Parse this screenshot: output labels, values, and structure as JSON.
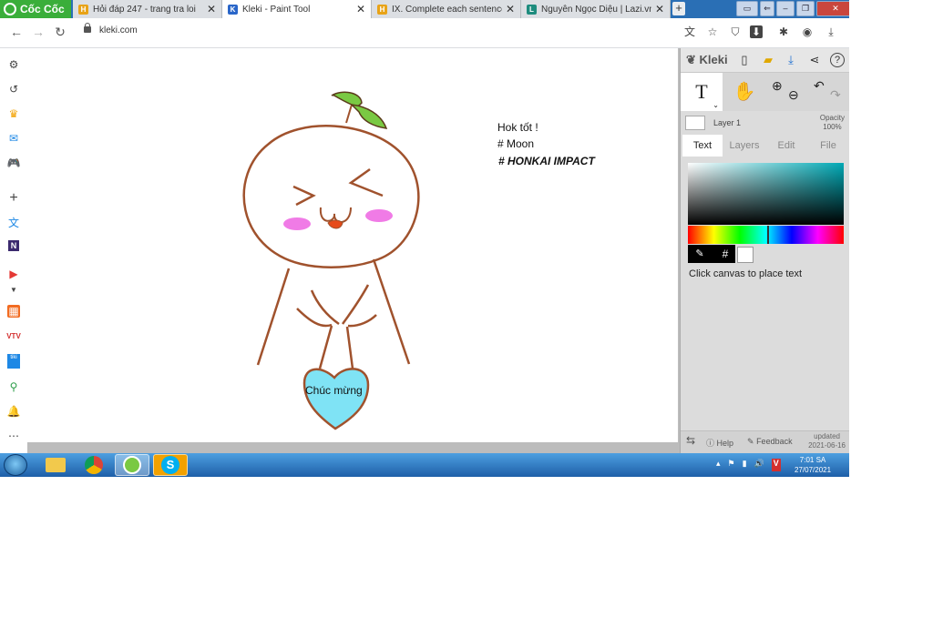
{
  "browser": {
    "brand": "Cốc Cốc",
    "tabs": [
      {
        "title": "Hỏi đáp 247 - trang tra loi",
        "favicon": "H",
        "color": "#e8a317",
        "active": false
      },
      {
        "title": "Kleki - Paint Tool",
        "favicon": "K",
        "color": "#2a66c9",
        "active": true
      },
      {
        "title": "IX. Complete each sentence",
        "favicon": "H",
        "color": "#e8a317",
        "active": false
      },
      {
        "title": "Nguyễn Ngọc Diệu | Lazi.vn",
        "favicon": "L",
        "color": "#1e8c7e",
        "active": false
      }
    ],
    "url": "kleki.com"
  },
  "canvas": {
    "text_line1": "Hok tốt !",
    "text_line2": "# Moon",
    "text_line3": "# HONKAI IMPACT",
    "heart_text": "Chúc mừng"
  },
  "panel": {
    "logo": "Kleki",
    "layer_name": "Layer 1",
    "opacity_label": "Opacity",
    "opacity_value": "100%",
    "tabs": [
      "Text",
      "Layers",
      "Edit",
      "File"
    ],
    "active_tab": "Text",
    "hint": "Click canvas to place text",
    "footer": {
      "help": "Help",
      "feedback": "Feedback",
      "updated_label": "updated",
      "updated_date": "2021-06-16"
    },
    "hash_label": "#"
  },
  "taskbar": {
    "time": "7:01 SA",
    "date": "27/07/2021"
  },
  "colors": {
    "drawing_stroke": "#a0522d",
    "heart_fill": "#7fe3f5",
    "leaf": "#7ac943",
    "blush": "#f07be6",
    "accent": "#2a66c9"
  }
}
